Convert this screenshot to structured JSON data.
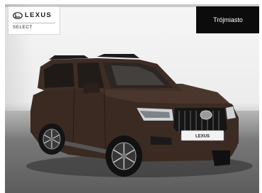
{
  "brand": {
    "wordmark": "LEXUS",
    "sub_label": "SELECT",
    "logo_icon": "lexus-logo-icon"
  },
  "location_button": {
    "label": "Trójmiasto"
  },
  "photo": {
    "subject": "vehicle-photo",
    "plate_text": "LEXUS"
  },
  "colors": {
    "button_bg": "#0c0c0c",
    "button_text": "#ffffff",
    "card_bg": "#ffffff"
  }
}
